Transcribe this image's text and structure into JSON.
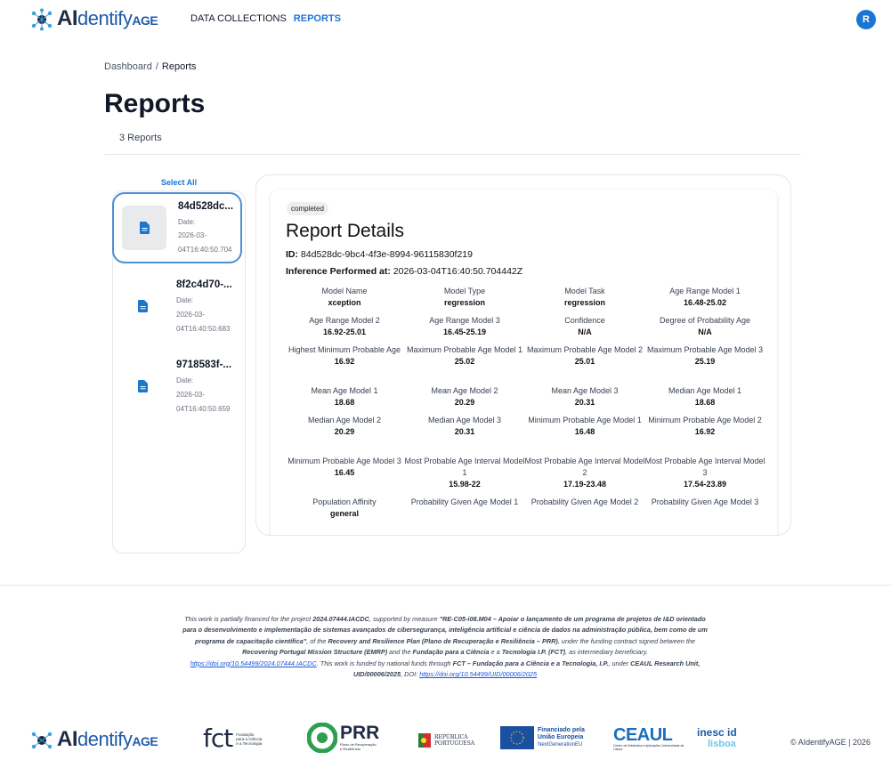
{
  "header": {
    "logo": {
      "ai": "AI",
      "dentify": "dentify",
      "age": "AGE"
    },
    "nav": [
      {
        "label": "DATA COLLECTIONS",
        "active": false
      },
      {
        "label": "REPORTS",
        "active": true
      }
    ],
    "avatar_initial": "R"
  },
  "breadcrumb": {
    "root": "Dashboard",
    "separator": "/",
    "current": "Reports"
  },
  "page": {
    "title": "Reports",
    "count_label": "3 Reports"
  },
  "list": {
    "select_all_label": "Select All",
    "items": [
      {
        "title": "84d528dc...",
        "date_label": "Date:",
        "date_line1": "2026-03-",
        "date_line2": "04T16:40:50.704",
        "icon": "document-icon",
        "selected": true
      },
      {
        "title": "8f2c4d70-...",
        "date_label": "Date:",
        "date_line1": "2026-03-",
        "date_line2": "04T16:40:50.683",
        "icon": "document-icon",
        "selected": false
      },
      {
        "title": "9718583f-...",
        "date_label": "Date:",
        "date_line1": "2026-03-",
        "date_line2": "04T16:40:50.659",
        "icon": "document-icon",
        "selected": false
      }
    ]
  },
  "details": {
    "status": "completed",
    "title": "Report Details",
    "id_label": "ID:",
    "id_value": "84d528dc-9bc4-4f3e-8994-96115830f219",
    "inference_label": "Inference Performed at:",
    "inference_value": "2026-03-04T16:40:50.704442Z",
    "fields": [
      {
        "label": "Model Name",
        "value": "xception"
      },
      {
        "label": "Model Type",
        "value": "regression"
      },
      {
        "label": "Model Task",
        "value": "regression"
      },
      {
        "label": "Age Range Model 1",
        "value": "16.48-25.02"
      },
      {
        "label": "Age Range Model 2",
        "value": "16.92-25.01"
      },
      {
        "label": "Age Range Model 3",
        "value": "16.45-25.19"
      },
      {
        "label": "Confidence",
        "value": "N/A"
      },
      {
        "label": "Degree of Probability Age",
        "value": "N/A"
      },
      {
        "label": "Highest Minimum Probable Age",
        "value": "16.92"
      },
      {
        "label": "Maximum Probable Age Model 1",
        "value": "25.02"
      },
      {
        "label": "Maximum Probable Age Model 2",
        "value": "25.01"
      },
      {
        "label": "Maximum Probable Age Model 3",
        "value": "25.19"
      },
      {
        "label": "Mean Age Model 1",
        "value": "18.68"
      },
      {
        "label": "Mean Age Model 2",
        "value": "20.29"
      },
      {
        "label": "Mean Age Model 3",
        "value": "20.31"
      },
      {
        "label": "Median Age Model 1",
        "value": "18.68"
      },
      {
        "label": "Median Age Model 2",
        "value": "20.29"
      },
      {
        "label": "Median Age Model 3",
        "value": "20.31"
      },
      {
        "label": "Minimum Probable Age Model 1",
        "value": "16.48"
      },
      {
        "label": "Minimum Probable Age Model 2",
        "value": "16.92"
      },
      {
        "label": "Minimum Probable Age Model 3",
        "value": "16.45"
      },
      {
        "label": "Most Probable Age Interval Model 1",
        "value": "15.98-22"
      },
      {
        "label": "Most Probable Age Interval Model 2",
        "value": "17.19-23.48"
      },
      {
        "label": "Most Probable Age Interval Model 3",
        "value": "17.54-23.89"
      },
      {
        "label": "Population Affinity",
        "value": "general"
      },
      {
        "label": "Probability Given Age Model 1",
        "value": ""
      },
      {
        "label": "Probability Given Age Model 2",
        "value": ""
      },
      {
        "label": "Probability Given Age Model 3",
        "value": ""
      }
    ]
  },
  "footer": {
    "funding": {
      "t1": "This work is partially financed for the project ",
      "project": "2024.07444.IACDC",
      "t2": ", supported by measure ",
      "measure": "\"RE-C05-i08.M04 – Apoiar o lançamento de um programa de projetos de I&D orientado para o desenvolvimento e implementação de sistemas avançados de cibersegurança, inteligência artificial e ciência de dados na administração pública, bem como de um programa de capacitação científica\"",
      "t3": ", of the ",
      "rrp": "Recovery and Resilience Plan (Plano de Recuperação e Resiliência – PRR)",
      "t4": ", under the funding contract signed between the ",
      "emrp": "Recovering Portugal Mission Structure (EMRP)",
      "t5": " and the ",
      "fct": "Fundação para a Ciência",
      "t6": " e a ",
      "fct2": "Tecnologia I.P. (FCT)",
      "t7": ", as intermediary beneficiary. ",
      "link1": "https://doi.org/10.54499/2024.07444.IACDC",
      "t8": ". This work is funded by national funds through ",
      "fct3": "FCT – Fundação para a Ciência e a Tecnologia, I.P.",
      "t9": ", under ",
      "ceaul": "CEAUL Research Unit, UID/00006/2025",
      "t10": ", DOI: ",
      "link2": "https://doi.org/10.54499/UID/00006/2025"
    },
    "partners": {
      "fct_small": [
        "Fundação",
        "para a Ciência",
        "e a Tecnologia"
      ],
      "prr_small": [
        "Plano de Recuperação",
        "e Resiliência"
      ],
      "republica": [
        "REPÚBLICA",
        "PORTUGUESA"
      ],
      "eu": [
        "Financiado pela",
        "União Europeia",
        "NextGenerationEU"
      ],
      "ceaul_small": "Centro de Estatística e Aplicações Universidade de Lisboa",
      "inesc": [
        "inesc id",
        "lisboa"
      ]
    },
    "copyright": "© AIdentifyAGE | 2026"
  },
  "colors": {
    "primary": "#1976d2",
    "logo_dark": "#1f2a44",
    "logo_blue": "#1f5aa8"
  }
}
